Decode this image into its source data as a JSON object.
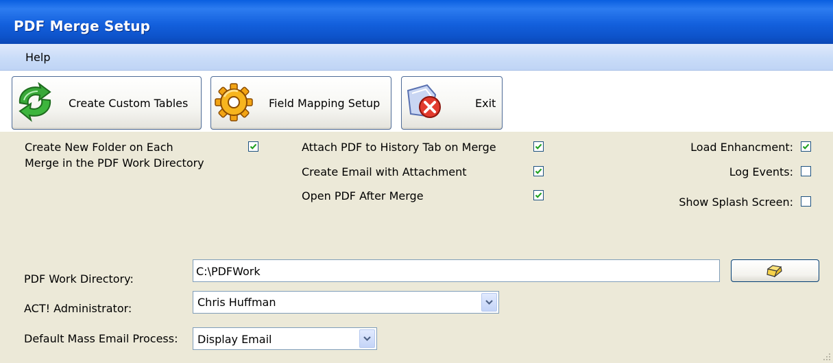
{
  "window": {
    "title": "PDF Merge Setup"
  },
  "menu": {
    "items": [
      "Help"
    ]
  },
  "toolbar": {
    "create_custom_tables": "Create Custom Tables",
    "field_mapping_setup": "Field Mapping Setup",
    "exit": "Exit"
  },
  "options": {
    "new_folder_line1": "Create New Folder on Each",
    "new_folder_line2": "Merge in the PDF Work Directory",
    "new_folder_checked": true,
    "attach_history": "Attach PDF to History Tab on Merge",
    "attach_history_checked": true,
    "create_email": "Create Email with Attachment",
    "create_email_checked": true,
    "open_pdf": "Open PDF After Merge",
    "open_pdf_checked": true,
    "load_enhancement": "Load Enhancment:",
    "load_enhancement_checked": true,
    "log_events": "Log Events:",
    "log_events_checked": false,
    "show_splash": "Show Splash Screen:",
    "show_splash_checked": false
  },
  "fields": {
    "work_dir_label": "PDF Work Directory:",
    "work_dir_value": "C:\\PDFWork",
    "admin_label": "ACT! Administrator:",
    "admin_value": "Chris Huffman",
    "mass_email_label": "Default Mass Email Process:",
    "mass_email_value": "Display Email"
  },
  "icons": {
    "create_tables": "green-arrows-icon",
    "field_mapping": "gear-icon",
    "exit": "exit-x-icon",
    "browse": "folder-icon"
  }
}
